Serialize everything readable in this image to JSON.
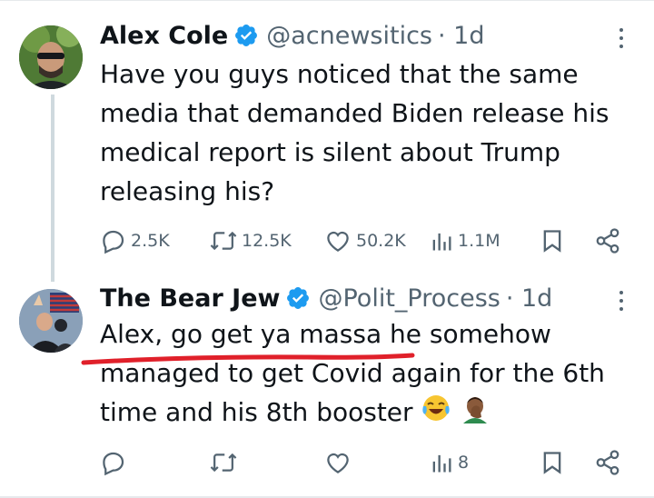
{
  "tweets": [
    {
      "name": "Alex Cole",
      "handle": "@acnewsitics",
      "time": "· 1d",
      "text_lines": [
        "Have you guys noticed that the same",
        "media that demanded Biden release his",
        "medical report is silent about Trump",
        "releasing his?"
      ],
      "stats": {
        "replies": "2.5K",
        "retweets": "12.5K",
        "likes": "50.2K",
        "views": "1.1M"
      }
    },
    {
      "name": "The Bear Jew",
      "handle": "@Polit_Process",
      "time": "· 1d",
      "text_lines": [
        "Alex, go get ya massa he somehow",
        "managed to get Covid again for the 6th",
        "time and his 8th booster"
      ],
      "emojis": [
        "tears-of-joy-emoji",
        "facepalm-emoji"
      ],
      "stats": {
        "replies": "",
        "retweets": "",
        "likes": "",
        "views": "8"
      }
    }
  ],
  "colors": {
    "text": "#0f1419",
    "secondary": "#536471",
    "verified": "#1d9bf0",
    "annotation_underline": "#e0202a",
    "thread_line": "#cfd9de"
  }
}
